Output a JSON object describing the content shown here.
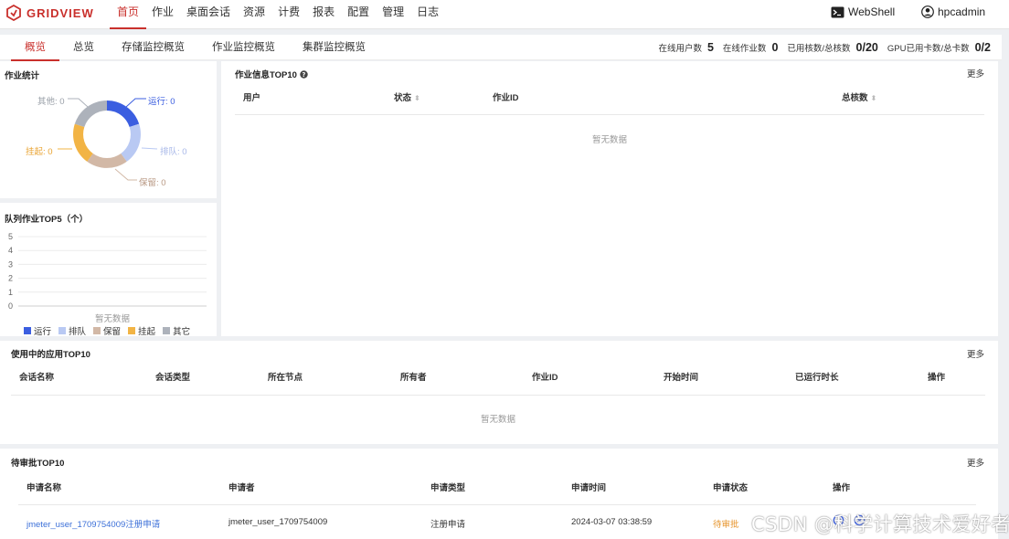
{
  "brand": {
    "name": "GRIDVIEW",
    "color": "#c9302c"
  },
  "nav": {
    "items": [
      {
        "label": "首页",
        "active": true
      },
      {
        "label": "作业"
      },
      {
        "label": "桌面会话"
      },
      {
        "label": "资源"
      },
      {
        "label": "计费"
      },
      {
        "label": "报表"
      },
      {
        "label": "配置"
      },
      {
        "label": "管理"
      },
      {
        "label": "日志"
      }
    ],
    "webshell": "WebShell",
    "user": "hpcadmin"
  },
  "subtabs": [
    {
      "label": "概览",
      "active": true
    },
    {
      "label": "总览"
    },
    {
      "label": "存储监控概览"
    },
    {
      "label": "作业监控概览"
    },
    {
      "label": "集群监控概览"
    }
  ],
  "stats": [
    {
      "label": "在线用户数",
      "value": "5"
    },
    {
      "label": "在线作业数",
      "value": "0"
    },
    {
      "label": "已用核数/总核数",
      "value": "0/20"
    },
    {
      "label": "GPU已用卡数/总卡数",
      "value": "0/2"
    }
  ],
  "job_stats": {
    "title": "作业统计",
    "segments": [
      {
        "label": "运行: 0",
        "color": "#3b5ee0",
        "value": 0
      },
      {
        "label": "排队: 0",
        "color": "#b9c9f3",
        "value": 0
      },
      {
        "label": "保留: 0",
        "color": "#d2b8a6",
        "value": 0
      },
      {
        "label": "挂起: 0",
        "color": "#f2b445",
        "value": 0
      },
      {
        "label": "其他: 0",
        "color": "#adb2bb",
        "value": 0
      }
    ]
  },
  "queue_top5": {
    "title": "队列作业TOP5（个）",
    "empty": "暂无数据",
    "legend": [
      "运行",
      "排队",
      "保留",
      "挂起",
      "其它"
    ],
    "legend_colors": [
      "#3b5ee0",
      "#b9c9f3",
      "#d2b8a6",
      "#f2b445",
      "#adb2bb"
    ]
  },
  "chart_data": {
    "type": "bar",
    "title": "队列作业TOP5（个）",
    "categories": [],
    "series": [
      {
        "name": "运行",
        "values": []
      },
      {
        "name": "排队",
        "values": []
      },
      {
        "name": "保留",
        "values": []
      },
      {
        "name": "挂起",
        "values": []
      },
      {
        "name": "其它",
        "values": []
      }
    ],
    "yticks": [
      "0",
      "1",
      "2",
      "3",
      "4",
      "5"
    ],
    "ylim": [
      0,
      5
    ],
    "grid": true,
    "legend": "bottom"
  },
  "job_top10": {
    "title": "作业信息TOP10",
    "more": "更多",
    "columns": [
      "用户",
      "状态",
      "作业ID",
      "总核数"
    ],
    "empty": "暂无数据"
  },
  "apps_top10": {
    "title": "使用中的应用TOP10",
    "more": "更多",
    "columns": [
      "会话名称",
      "会话类型",
      "所在节点",
      "所有者",
      "作业ID",
      "开始时间",
      "已运行时长",
      "操作"
    ],
    "empty": "暂无数据"
  },
  "pending_top10": {
    "title": "待审批TOP10",
    "more": "更多",
    "columns": [
      "申请名称",
      "申请者",
      "申请类型",
      "申请时间",
      "申请状态",
      "操作"
    ],
    "rows": [
      {
        "name": "jmeter_user_1709754009注册申请",
        "applicant": "jmeter_user_1709754009",
        "type": "注册申请",
        "time": "2024-03-07 03:38:59",
        "status": "待审批"
      }
    ]
  },
  "watermark": "CSDN @科学计算技术爱好者"
}
